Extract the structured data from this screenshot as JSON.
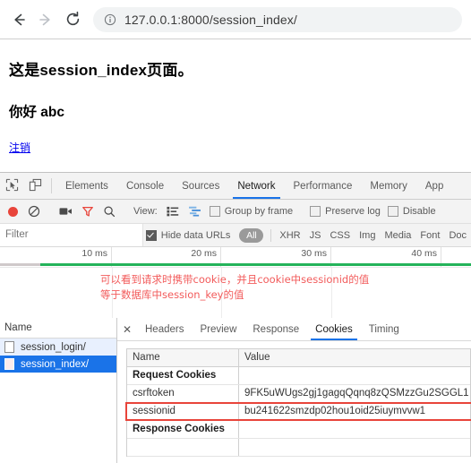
{
  "browser": {
    "back_icon": "arrow-left-icon",
    "forward_icon": "arrow-right-icon",
    "reload_icon": "reload-icon",
    "info_icon": "info-circle-icon",
    "url": "127.0.0.1:8000/session_index/"
  },
  "webpage": {
    "heading": "这是session_index页面。",
    "greeting": "你好 abc",
    "logout_link": "注销"
  },
  "devtools": {
    "inspect_icon": "inspect-element-icon",
    "device_icon": "device-toolbar-icon",
    "tabs": [
      {
        "label": "Elements",
        "active": false
      },
      {
        "label": "Console",
        "active": false
      },
      {
        "label": "Sources",
        "active": false
      },
      {
        "label": "Network",
        "active": true
      },
      {
        "label": "Performance",
        "active": false
      },
      {
        "label": "Memory",
        "active": false
      },
      {
        "label": "App",
        "active": false
      }
    ],
    "toolbar": {
      "record_icon": "record-button-icon",
      "clear_icon": "clear-no-entry-icon",
      "camera_icon": "screenshot-camera-icon",
      "filter_icon": "funnel-filter-icon",
      "search_icon": "search-magnifier-icon",
      "view_label": "View:",
      "list_view_icon": "list-view-icon",
      "waterfall_view_icon": "waterfall-view-icon",
      "group_by_frame": {
        "label": "Group by frame",
        "checked": false
      },
      "preserve_log": {
        "label": "Preserve log",
        "checked": false
      },
      "disable_cache": {
        "label": "Disable",
        "checked": false
      }
    },
    "filterbar": {
      "filter_placeholder": "Filter",
      "filter_value": "",
      "hide_data_urls": {
        "label": "Hide data URLs",
        "checked": true
      },
      "chips": [
        "All",
        "XHR",
        "JS",
        "CSS",
        "Img",
        "Media",
        "Font",
        "Doc"
      ],
      "active_chip": "All"
    },
    "overview": {
      "ticks": [
        "10 ms",
        "20 ms",
        "30 ms",
        "40 ms"
      ],
      "bar_color": "#24b35a"
    },
    "annotation": {
      "line1": "可以看到请求时携带cookie，并且cookie中sessionid的值",
      "line2": "等于数据库中session_key的值",
      "color": "#f25b5b"
    },
    "request_list": {
      "header": "Name",
      "rows": [
        {
          "name": "session_login/",
          "selected": false
        },
        {
          "name": "session_index/",
          "selected": true
        }
      ]
    },
    "detail": {
      "close_label": "✕",
      "tabs": [
        {
          "label": "Headers",
          "active": false
        },
        {
          "label": "Preview",
          "active": false
        },
        {
          "label": "Response",
          "active": false
        },
        {
          "label": "Cookies",
          "active": true
        },
        {
          "label": "Timing",
          "active": false
        }
      ],
      "cookies": {
        "col_name": "Name",
        "col_value": "Value",
        "rows": [
          {
            "name": "Request Cookies",
            "value": "",
            "group": true,
            "highlight": false
          },
          {
            "name": "csrftoken",
            "value": "9FK5uWUgs2gj1gagqQqnq8zQSMzzGu2SGGL1",
            "group": false,
            "highlight": false
          },
          {
            "name": "sessionid",
            "value": "bu241622smzdp02hou1oid25iuymvvw1",
            "group": false,
            "highlight": true
          },
          {
            "name": "Response Cookies",
            "value": "",
            "group": true,
            "highlight": false
          },
          {
            "name": "",
            "value": "",
            "group": false,
            "highlight": false
          }
        ]
      }
    }
  }
}
